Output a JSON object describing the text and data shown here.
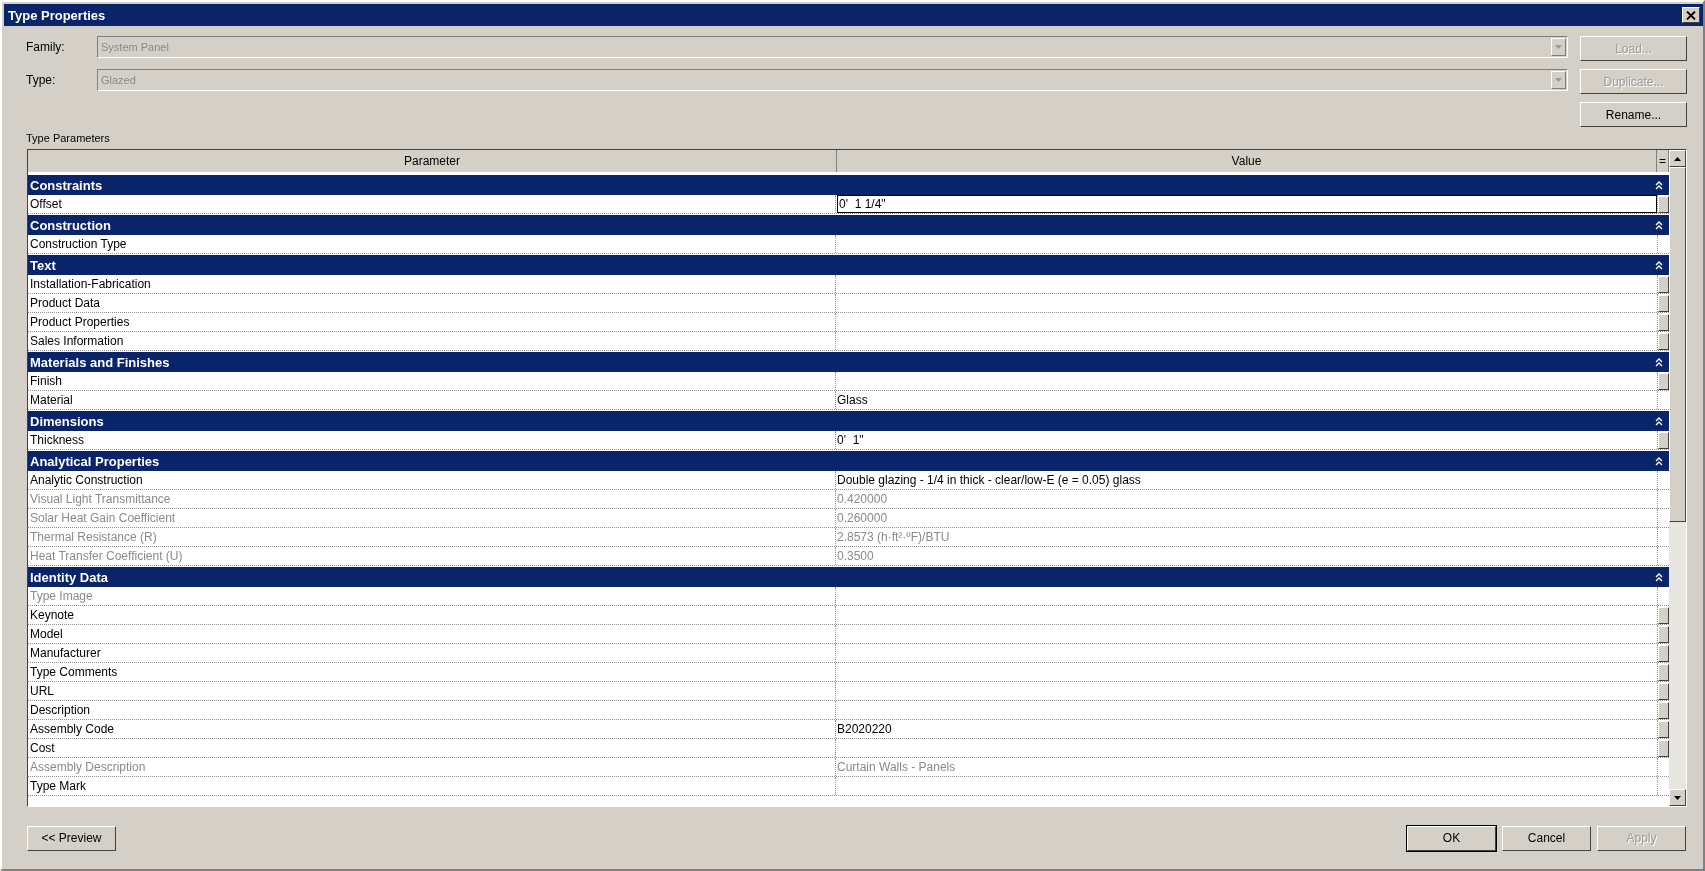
{
  "window": {
    "title": "Type Properties"
  },
  "fields": [
    {
      "label": "Family:",
      "value": "System Panel",
      "disabled": true
    },
    {
      "label": "Type:",
      "value": "Glazed",
      "disabled": true
    }
  ],
  "side_buttons": [
    {
      "label": "Load...",
      "disabled": true
    },
    {
      "label": "Duplicate...",
      "disabled": true
    },
    {
      "label": "Rename...",
      "disabled": false
    }
  ],
  "section_label": "Type Parameters",
  "table": {
    "columns": [
      "Parameter",
      "Value"
    ],
    "column_menu": "=",
    "groups": [
      {
        "name": "Constraints",
        "expanded": true,
        "rows": [
          {
            "parameter": "Offset",
            "value": "0'  1 1/4\"",
            "disabled": false,
            "selected": true,
            "linkable": true
          }
        ]
      },
      {
        "name": "Construction",
        "expanded": true,
        "rows": [
          {
            "parameter": "Construction Type",
            "value": "",
            "disabled": false,
            "selected": false,
            "linkable": false
          }
        ]
      },
      {
        "name": "Text",
        "expanded": true,
        "rows": [
          {
            "parameter": "Installation-Fabrication",
            "value": "",
            "disabled": false,
            "selected": false,
            "linkable": true
          },
          {
            "parameter": "Product Data",
            "value": "",
            "disabled": false,
            "selected": false,
            "linkable": true
          },
          {
            "parameter": "Product Properties",
            "value": "",
            "disabled": false,
            "selected": false,
            "linkable": true
          },
          {
            "parameter": "Sales Information",
            "value": "",
            "disabled": false,
            "selected": false,
            "linkable": true
          }
        ]
      },
      {
        "name": "Materials and Finishes",
        "expanded": true,
        "rows": [
          {
            "parameter": "Finish",
            "value": "",
            "disabled": false,
            "selected": false,
            "linkable": true
          },
          {
            "parameter": "Material",
            "value": "Glass",
            "disabled": false,
            "selected": false,
            "linkable": false
          }
        ]
      },
      {
        "name": "Dimensions",
        "expanded": true,
        "rows": [
          {
            "parameter": "Thickness",
            "value": "0'  1\"",
            "disabled": false,
            "selected": false,
            "linkable": true
          }
        ]
      },
      {
        "name": "Analytical Properties",
        "expanded": true,
        "rows": [
          {
            "parameter": "Analytic Construction",
            "value": "Double glazing - 1/4 in thick - clear/low-E (e = 0.05) glass",
            "disabled": false,
            "selected": false,
            "linkable": false
          },
          {
            "parameter": "Visual Light Transmittance",
            "value": "0.420000",
            "disabled": true,
            "selected": false,
            "linkable": false
          },
          {
            "parameter": "Solar Heat Gain Coefficient",
            "value": "0.260000",
            "disabled": true,
            "selected": false,
            "linkable": false
          },
          {
            "parameter": "Thermal Resistance (R)",
            "value": "2.8573 (h·ft²·ºF)/BTU",
            "disabled": true,
            "selected": false,
            "linkable": false
          },
          {
            "parameter": "Heat Transfer Coefficient (U)",
            "value": "0.3500",
            "disabled": true,
            "selected": false,
            "linkable": false
          }
        ]
      },
      {
        "name": "Identity Data",
        "expanded": true,
        "rows": [
          {
            "parameter": "Type Image",
            "value": "",
            "disabled": true,
            "selected": false,
            "linkable": false
          },
          {
            "parameter": "Keynote",
            "value": "",
            "disabled": false,
            "selected": false,
            "linkable": true
          },
          {
            "parameter": "Model",
            "value": "",
            "disabled": false,
            "selected": false,
            "linkable": true
          },
          {
            "parameter": "Manufacturer",
            "value": "",
            "disabled": false,
            "selected": false,
            "linkable": true
          },
          {
            "parameter": "Type Comments",
            "value": "",
            "disabled": false,
            "selected": false,
            "linkable": true
          },
          {
            "parameter": "URL",
            "value": "",
            "disabled": false,
            "selected": false,
            "linkable": true
          },
          {
            "parameter": "Description",
            "value": "",
            "disabled": false,
            "selected": false,
            "linkable": true
          },
          {
            "parameter": "Assembly Code",
            "value": "B2020220",
            "disabled": false,
            "selected": false,
            "linkable": true
          },
          {
            "parameter": "Cost",
            "value": "",
            "disabled": false,
            "selected": false,
            "linkable": true
          },
          {
            "parameter": "Assembly Description",
            "value": "Curtain Walls - Panels",
            "disabled": true,
            "selected": false,
            "linkable": false
          },
          {
            "parameter": "Type Mark",
            "value": "",
            "disabled": false,
            "selected": false,
            "linkable": false
          }
        ]
      }
    ]
  },
  "footer": {
    "preview_button": {
      "label": "<< Preview"
    },
    "buttons": [
      {
        "label": "OK",
        "default": true,
        "disabled": false
      },
      {
        "label": "Cancel",
        "default": false,
        "disabled": false
      },
      {
        "label": "Apply",
        "default": false,
        "disabled": true
      }
    ]
  }
}
